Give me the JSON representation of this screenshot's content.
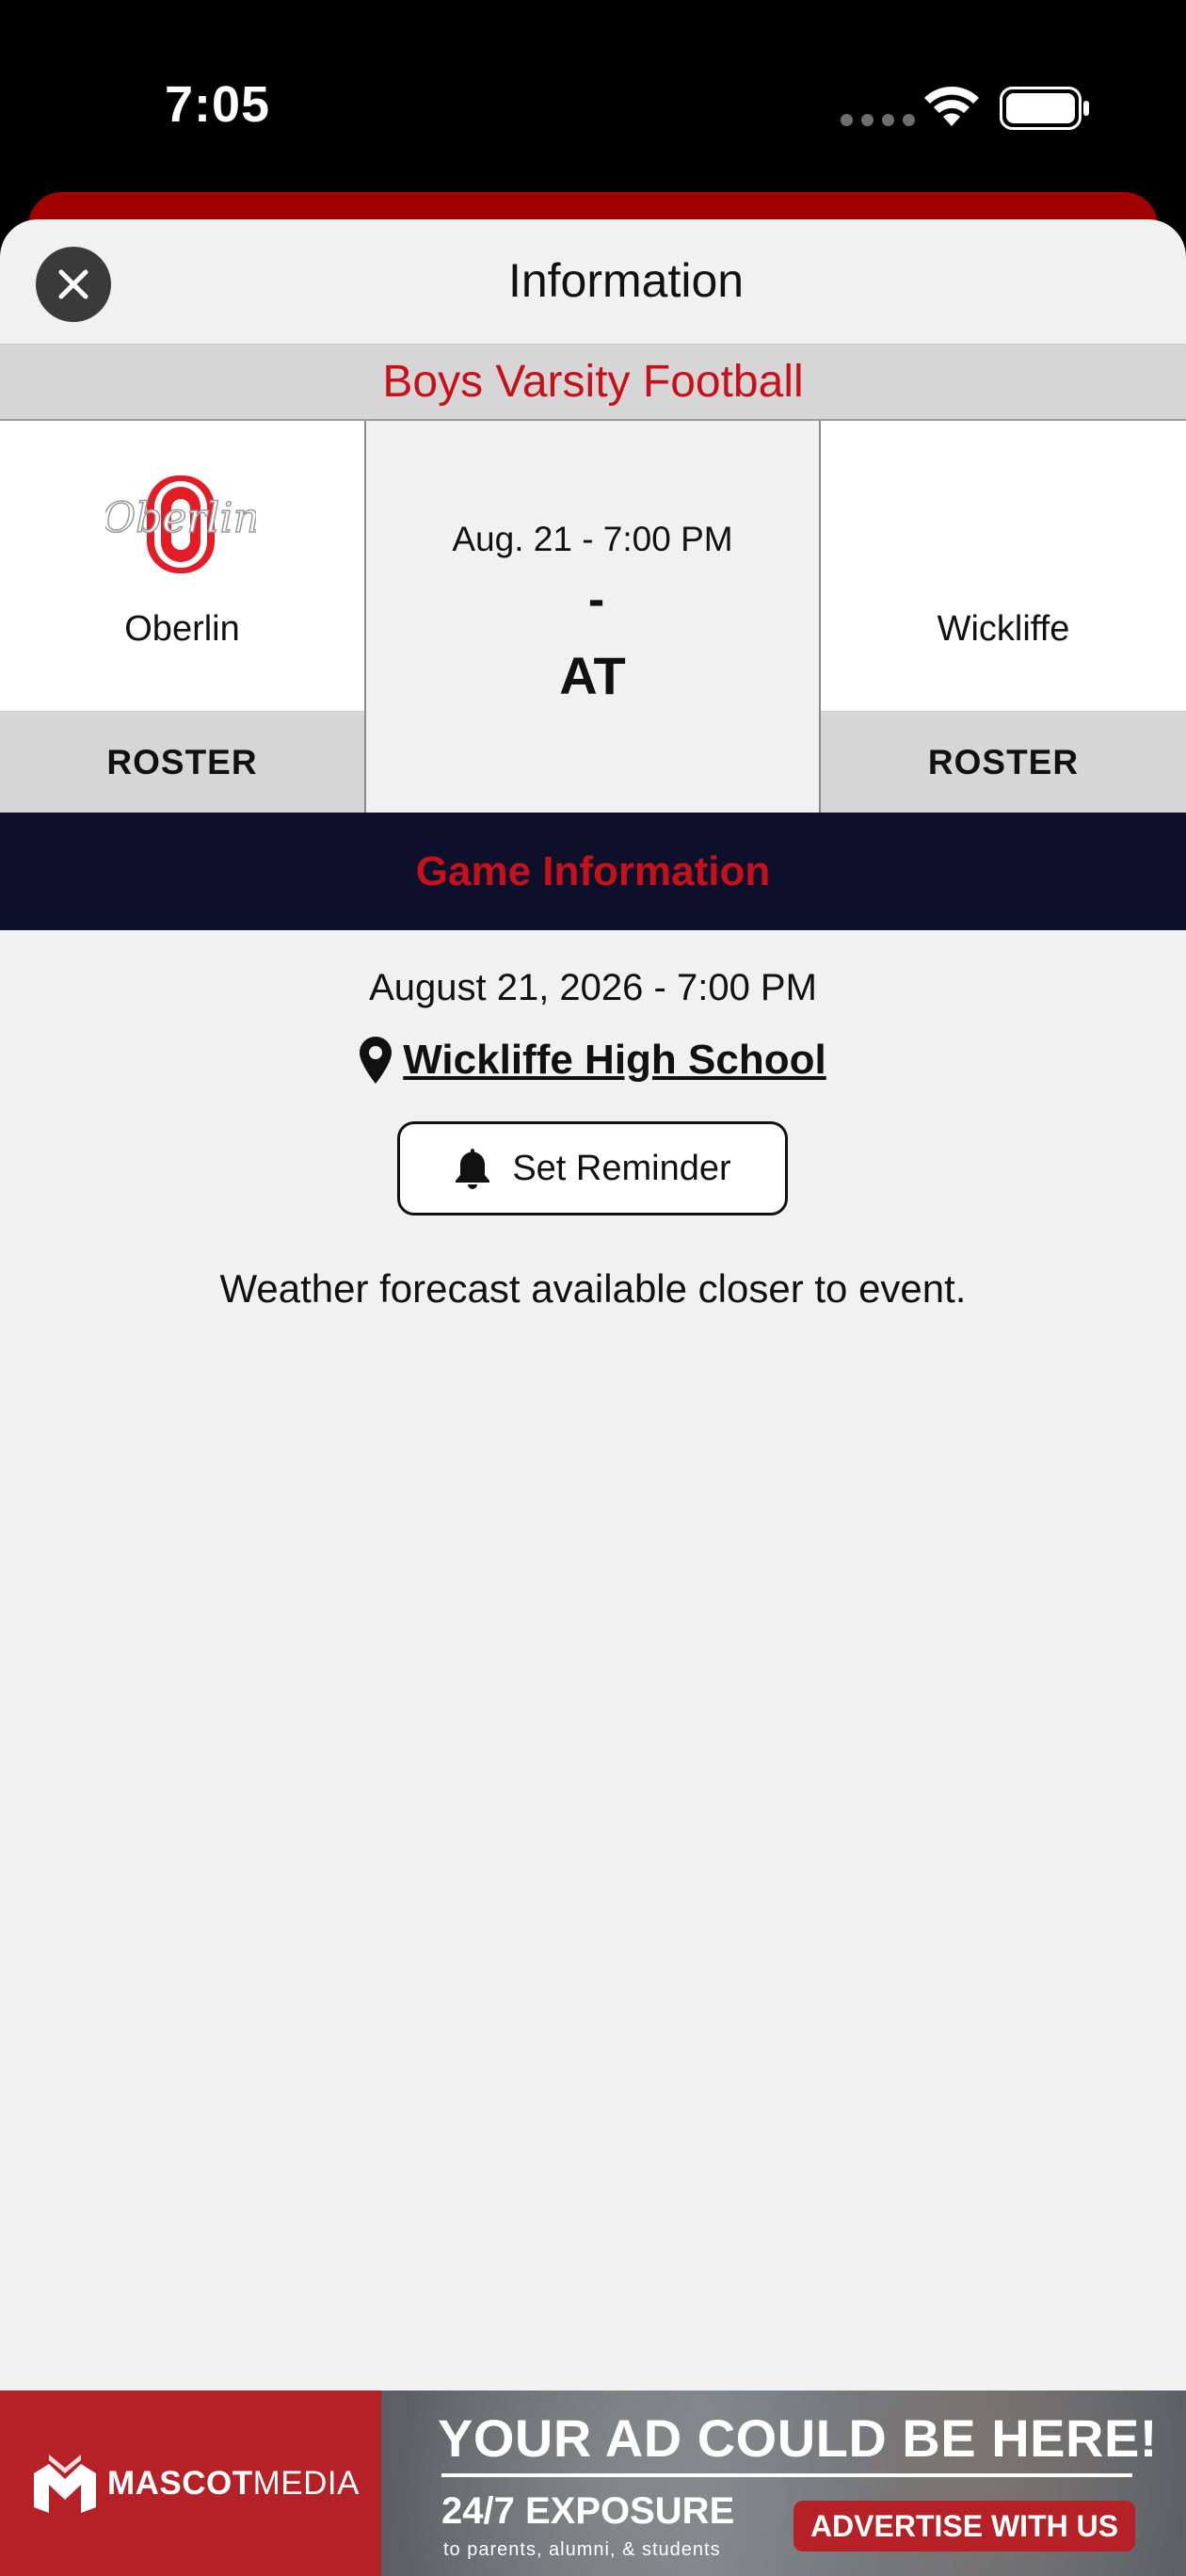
{
  "status_bar": {
    "time": "7:05",
    "icons": [
      "signal-dots-icon",
      "wifi-icon",
      "battery-icon"
    ]
  },
  "header": {
    "title": "Information",
    "close_icon": "close-icon"
  },
  "sport": {
    "title": "Boys Varsity Football"
  },
  "matchup": {
    "home": {
      "name": "Oberlin",
      "logo_text": "Oberlin",
      "roster_label": "ROSTER"
    },
    "away": {
      "name": "Wickliffe",
      "roster_label": "ROSTER"
    },
    "datetime": "Aug. 21 - 7:00 PM",
    "score": "-",
    "location_type": "AT"
  },
  "game_info": {
    "section_title": "Game Information",
    "full_date": "August 21, 2026 - 7:00 PM",
    "location_icon": "map-pin-icon",
    "location": "Wickliffe High School",
    "reminder_icon": "bell-icon",
    "reminder_label": "Set Reminder",
    "weather_note": "Weather forecast available closer to event."
  },
  "ad": {
    "brand_bold": "MASCOT",
    "brand_light": "MEDIA",
    "headline": "YOUR AD COULD BE HERE!",
    "exposure": "24/7 EXPOSURE",
    "sub": "to parents, alumni, & students",
    "cta": "ADVERTISE WITH US"
  },
  "colors": {
    "accent_red": "#c8101a",
    "navy": "#0d102b",
    "ad_red": "#b52126"
  }
}
